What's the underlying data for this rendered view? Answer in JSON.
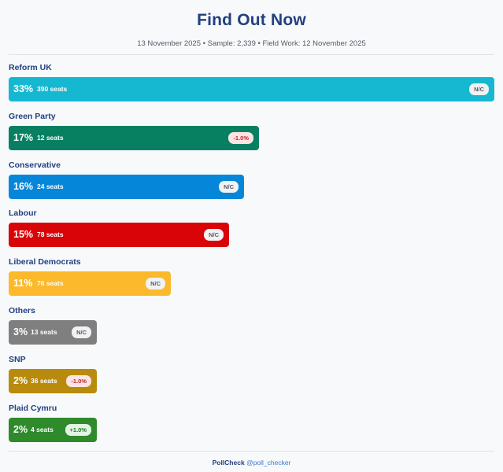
{
  "header": {
    "title": "Find Out Now",
    "subtitle": "13 November 2025 • Sample: 2,339 • Field Work: 12 November 2025"
  },
  "footer": {
    "brand": "PollCheck",
    "handle": "@poll_checker"
  },
  "chart_data": {
    "type": "bar",
    "orientation": "horizontal",
    "title": "Find Out Now",
    "subtitle": "13 November 2025 • Sample: 2,339 • Field Work: 12 November 2025",
    "xlim": [
      0,
      33
    ],
    "grid": false,
    "categories": [
      "Reform UK",
      "Green Party",
      "Conservative",
      "Labour",
      "Liberal Democrats",
      "Others",
      "SNP",
      "Plaid Cymru"
    ],
    "values": [
      33,
      17,
      16,
      15,
      11,
      3,
      2,
      2
    ],
    "bars": [
      {
        "party": "Reform UK",
        "value": 33,
        "pct_label": "33%",
        "seats": "390 seats",
        "change": "N/C",
        "change_type": "nc",
        "color": "#16b8d1"
      },
      {
        "party": "Green Party",
        "value": 17,
        "pct_label": "17%",
        "seats": "12 seats",
        "change": "-1.0%",
        "change_type": "neg",
        "color": "#078062"
      },
      {
        "party": "Conservative",
        "value": 16,
        "pct_label": "16%",
        "seats": "24 seats",
        "change": "N/C",
        "change_type": "nc",
        "color": "#0686d8"
      },
      {
        "party": "Labour",
        "value": 15,
        "pct_label": "15%",
        "seats": "78 seats",
        "change": "N/C",
        "change_type": "nc",
        "color": "#d80407"
      },
      {
        "party": "Liberal Democrats",
        "value": 11,
        "pct_label": "11%",
        "seats": "76 seats",
        "change": "N/C",
        "change_type": "nc",
        "color": "#fbb92b"
      },
      {
        "party": "Others",
        "value": 3,
        "pct_label": "3%",
        "seats": "13 seats",
        "change": "N/C",
        "change_type": "nc",
        "color": "#7f7f7f"
      },
      {
        "party": "SNP",
        "value": 2,
        "pct_label": "2%",
        "seats": "36 seats",
        "change": "-1.0%",
        "change_type": "neg",
        "color": "#b88b0c"
      },
      {
        "party": "Plaid Cymru",
        "value": 2,
        "pct_label": "2%",
        "seats": "4 seats",
        "change": "+1.0%",
        "change_type": "pos",
        "color": "#2f8a2c"
      }
    ]
  }
}
